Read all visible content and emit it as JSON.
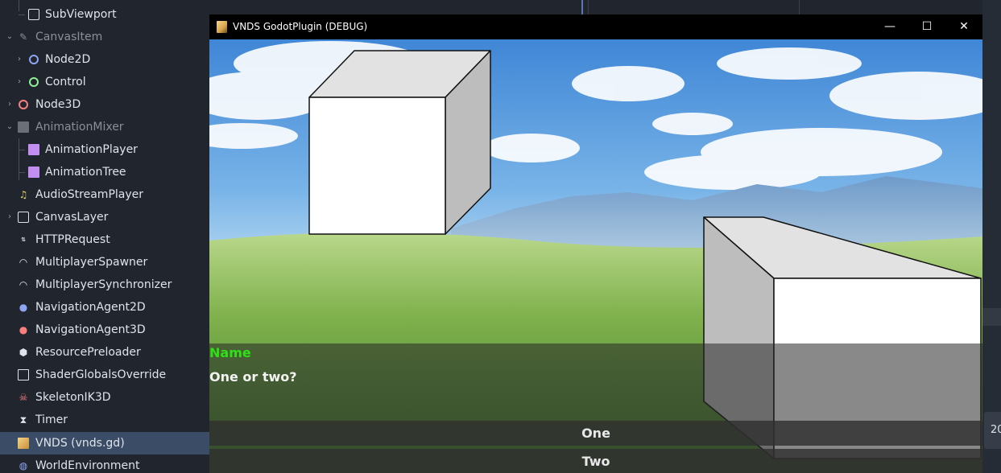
{
  "scene_tree": {
    "items": [
      {
        "label": "SubViewport",
        "icon": "subviewport-icon"
      },
      {
        "label": "CanvasItem",
        "icon": "pencil-icon"
      },
      {
        "label": "Node2D",
        "icon": "node2d-icon"
      },
      {
        "label": "Control",
        "icon": "control-icon"
      },
      {
        "label": "Node3D",
        "icon": "node3d-icon"
      },
      {
        "label": "AnimationMixer",
        "icon": "film-icon"
      },
      {
        "label": "AnimationPlayer",
        "icon": "film-icon"
      },
      {
        "label": "AnimationTree",
        "icon": "animation-tree-icon"
      },
      {
        "label": "AudioStreamPlayer",
        "icon": "music-note-icon"
      },
      {
        "label": "CanvasLayer",
        "icon": "canvas-layer-icon"
      },
      {
        "label": "HTTPRequest",
        "icon": "http-icon"
      },
      {
        "label": "MultiplayerSpawner",
        "icon": "wifi-icon"
      },
      {
        "label": "MultiplayerSynchronizer",
        "icon": "wifi-icon"
      },
      {
        "label": "NavigationAgent2D",
        "icon": "location-pin-icon"
      },
      {
        "label": "NavigationAgent3D",
        "icon": "location-pin-icon"
      },
      {
        "label": "ResourcePreloader",
        "icon": "box-icon"
      },
      {
        "label": "ShaderGlobalsOverride",
        "icon": "shader-icon"
      },
      {
        "label": "SkeletonIK3D",
        "icon": "skull-icon"
      },
      {
        "label": "Timer",
        "icon": "hourglass-icon"
      },
      {
        "label": "VNDS (vnds.gd)",
        "icon": "vnds-script-icon"
      },
      {
        "label": "WorldEnvironment",
        "icon": "globe-icon"
      }
    ]
  },
  "game_window": {
    "title": "VNDS GodotPlugin (DEBUG)",
    "minimize_glyph": "—",
    "maximize_glyph": "☐",
    "close_glyph": "✕"
  },
  "dialogue": {
    "speaker": "Name",
    "text": "One or two?",
    "choices": [
      "One",
      "Two"
    ]
  },
  "right_panel": {
    "tab_text": "20"
  },
  "colors": {
    "editor_bg": "#21262e",
    "selection": "#3b4d66",
    "speaker_name": "#2ee016"
  }
}
